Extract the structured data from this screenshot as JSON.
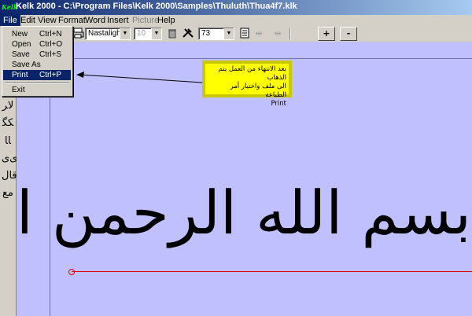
{
  "window": {
    "title": "Kelk 2000 - C:\\Program Files\\Kelk 2000\\Samples\\Thuluth\\Thua4f7.klk",
    "icon_label": "Kelk"
  },
  "menubar": {
    "items": [
      "File",
      "Edit",
      "View",
      "Format",
      "Word",
      "Insert",
      "Picture",
      "Help"
    ]
  },
  "file_menu": {
    "items": [
      {
        "label": "New",
        "shortcut": "Ctrl+N"
      },
      {
        "label": "Open",
        "shortcut": "Ctrl+O"
      },
      {
        "label": "Save",
        "shortcut": "Ctrl+S"
      },
      {
        "label": "Save As",
        "shortcut": ""
      },
      {
        "label": "Print",
        "shortcut": "Ctrl+P"
      },
      {
        "label": "Exit",
        "shortcut": ""
      }
    ],
    "highlighted": "Print"
  },
  "toolbar": {
    "font": "Nastaligh",
    "size": "10",
    "zoom": "73",
    "plus_label": "+",
    "minus_label": "-"
  },
  "palette": {
    "glyphs": [
      "ﻻﺮ",
      "ﻜﮕ",
      "ﺎﺎ",
      "ﯼﯼ",
      "ﻗﺎﻝ",
      "ﻣﻊ"
    ]
  },
  "callout": {
    "line1": "بعد الانتهاء من العمل يتم الذهاب",
    "line2": "الى ملف واختيار أمر الطباعة",
    "line3": "Print"
  },
  "document": {
    "text": "بسم الله الرحمن الرحيم"
  },
  "colors": {
    "canvas": "#c0c0ff",
    "callout": "#ffff00",
    "title_start": "#0a246a",
    "baseline": "#e00000"
  }
}
